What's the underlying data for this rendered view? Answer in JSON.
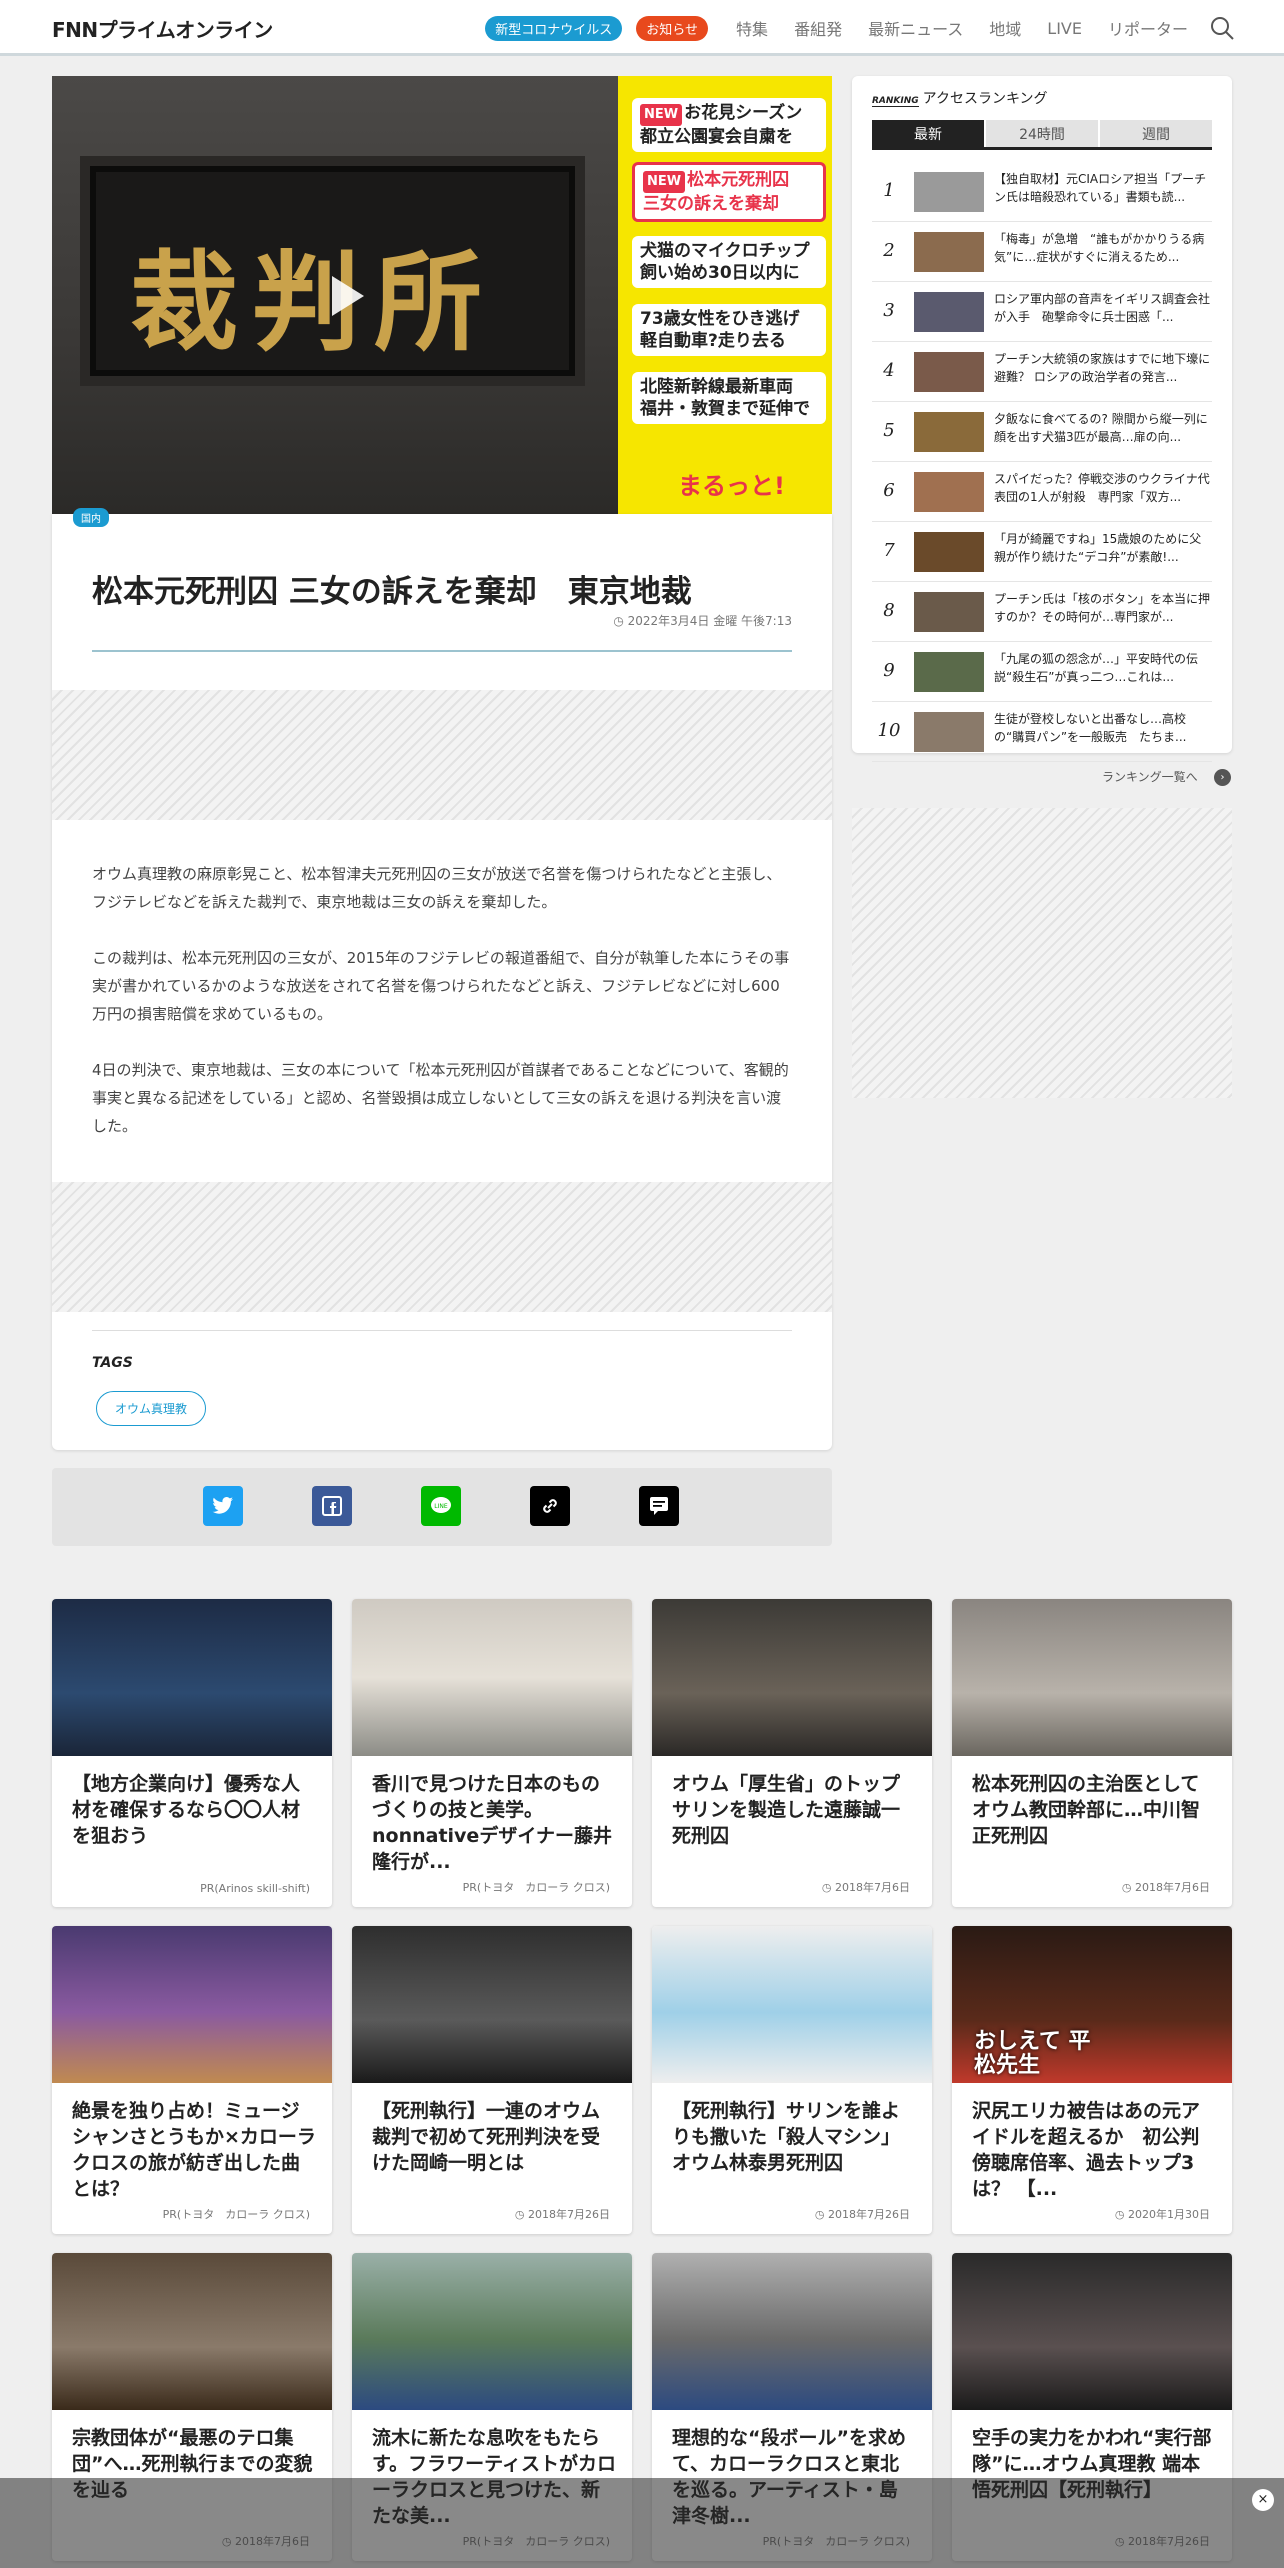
{
  "header": {
    "logo": "FNNプライムオンライン",
    "pill_corona": "新型コロナウイルス",
    "pill_notice": "お知らせ",
    "nav": [
      "特集",
      "番組発",
      "最新ニュース",
      "地域",
      "LIVE",
      "リポーター"
    ]
  },
  "hero": {
    "plaque_text": "裁判所",
    "headlines": [
      {
        "badge": "NEW",
        "line1": "お花見シーズン",
        "line2": "都立公園宴会自粛を"
      },
      {
        "badge": "NEW",
        "line1": "松本元死刑囚",
        "line2": "三女の訴えを棄却"
      },
      {
        "line1": "犬猫のマイクロチップ",
        "line2": "飼い始め30日以内に"
      },
      {
        "line1": "73歳女性をひき逃げ",
        "line2": "軽自動車?走り去る"
      },
      {
        "line1": "北陸新幹線最新車両",
        "line2": "福井・敦賀まで延伸で"
      }
    ],
    "maru": "まるっと!",
    "category": "国内"
  },
  "article": {
    "title": "松本元死刑囚 三女の訴えを棄却　東京地裁",
    "date": "2022年3月4日 金曜 午後7:13",
    "paragraphs": [
      "オウム真理教の麻原彰晃こと、松本智津夫元死刑囚の三女が放送で名誉を傷つけられたなどと主張し、フジテレビなどを訴えた裁判で、東京地裁は三女の訴えを棄却した。",
      "この裁判は、松本元死刑囚の三女が、2015年のフジテレビの報道番組で、自分が執筆した本にうその事実が書かれているかのような放送をされて名誉を傷つけられたなどと訴え、フジテレビなどに対し600万円の損害賠償を求めているもの。",
      "4日の判決で、東京地裁は、三女の本について「松本元死刑囚が首謀者であることなどについて、客観的事実と異なる記述をしている」と認め、名誉毀損は成立しないとして三女の訴えを退ける判決を言い渡した。"
    ],
    "tags_heading": "TAGS",
    "tags": [
      "オウム真理教"
    ]
  },
  "ranking": {
    "heading": "アクセスランキング",
    "icon_label": "RANKING",
    "tabs": [
      "最新",
      "24時間",
      "週間"
    ],
    "items": [
      {
        "num": "1",
        "text": "【独自取材】元CIAロシア担当「プーチン氏は暗殺恐れている」書類も読..."
      },
      {
        "num": "2",
        "text": "「梅毒」が急増　“誰もがかかりうる病気”に…症状がすぐに消えるため..."
      },
      {
        "num": "3",
        "text": "ロシア軍内部の音声をイギリス調査会社が入手　砲撃命令に兵士困惑「..."
      },
      {
        "num": "4",
        "text": "プーチン大統領の家族はすでに地下壕に避難？ ロシアの政治学者の発言..."
      },
      {
        "num": "5",
        "text": "夕飯なに食べてるの? 隙間から縦一列に顔を出す犬猫3匹が最高…扉の向..."
      },
      {
        "num": "6",
        "text": "スパイだった？停戦交渉のウクライナ代表団の1人が射殺　専門家「双方..."
      },
      {
        "num": "7",
        "text": "「月が綺麗ですね」15歳娘のために父親が作り続けた“デコ弁”が素敵!..."
      },
      {
        "num": "8",
        "text": "プーチン氏は「核のボタン」を本当に押すのか？その時何が…専門家が..."
      },
      {
        "num": "9",
        "text": "「九尾の狐の怨念が…」平安時代の伝説“殺生石”が真っ二つ…これは..."
      },
      {
        "num": "10",
        "text": "生徒が登校しないと出番なし…高校の“購買パン”を一般販売　たちま..."
      }
    ],
    "more": "ランキング一覧へ"
  },
  "cards": [
    {
      "title": "【地方企業向け】優秀な人材を確保するなら〇〇人材を狙おう",
      "foot": "PR(Arinos skill-shift)",
      "dated": false
    },
    {
      "title": "香川で見つけた日本のものづくりの技と美学。nonnativeデザイナー藤井隆行が...",
      "foot": "PR(トヨタ　カローラ クロス)",
      "dated": false
    },
    {
      "title": "オウム「厚生省」のトップ　サリンを製造した遠藤誠一死刑囚",
      "foot": "2018年7月6日",
      "dated": true
    },
    {
      "title": "松本死刑囚の主治医としてオウム教団幹部に…中川智正死刑囚",
      "foot": "2018年7月6日",
      "dated": true
    },
    {
      "title": "絶景を独り占め！ミュージシャンさとうもか×カローラクロスの旅が紡ぎ出した曲とは？",
      "foot": "PR(トヨタ　カローラ クロス)",
      "dated": false
    },
    {
      "title": "【死刑執行】一連のオウム裁判で初めて死刑判決を受けた岡崎一明とは",
      "foot": "2018年7月26日",
      "dated": true
    },
    {
      "title": "【死刑執行】サリンを誰よりも撒いた「殺人マシン」オウム林泰男死刑囚",
      "foot": "2018年7月26日",
      "dated": true
    },
    {
      "title": "沢尻エリカ被告はあの元アイドルを超えるか　初公判傍聴席倍率、過去トップ3は？ 【...",
      "foot": "2020年1月30日",
      "dated": true
    },
    {
      "title": "宗教団体が“最悪のテロ集団”へ…死刑執行までの変貌を辿る",
      "foot": "2018年7月6日",
      "dated": true
    },
    {
      "title": "流木に新たな息吹をもたらす。フラワーティストがカローラクロスと見つけた、新たな美...",
      "foot": "PR(トヨタ　カローラ クロス)",
      "dated": false
    },
    {
      "title": "理想的な“段ボール”を求めて、カローラクロスと東北を巡る。アーティスト・島津冬樹...",
      "foot": "PR(トヨタ　カローラ クロス)",
      "dated": false
    },
    {
      "title": "空手の実力をかわれ“実行部隊”に…オウム真理教 端本悟死刑囚【死刑執行】",
      "foot": "2018年7月26日",
      "dated": true
    }
  ],
  "card_thumb_labels": {
    "card8": "おしえて 平松先生"
  },
  "overlay_close": "×"
}
